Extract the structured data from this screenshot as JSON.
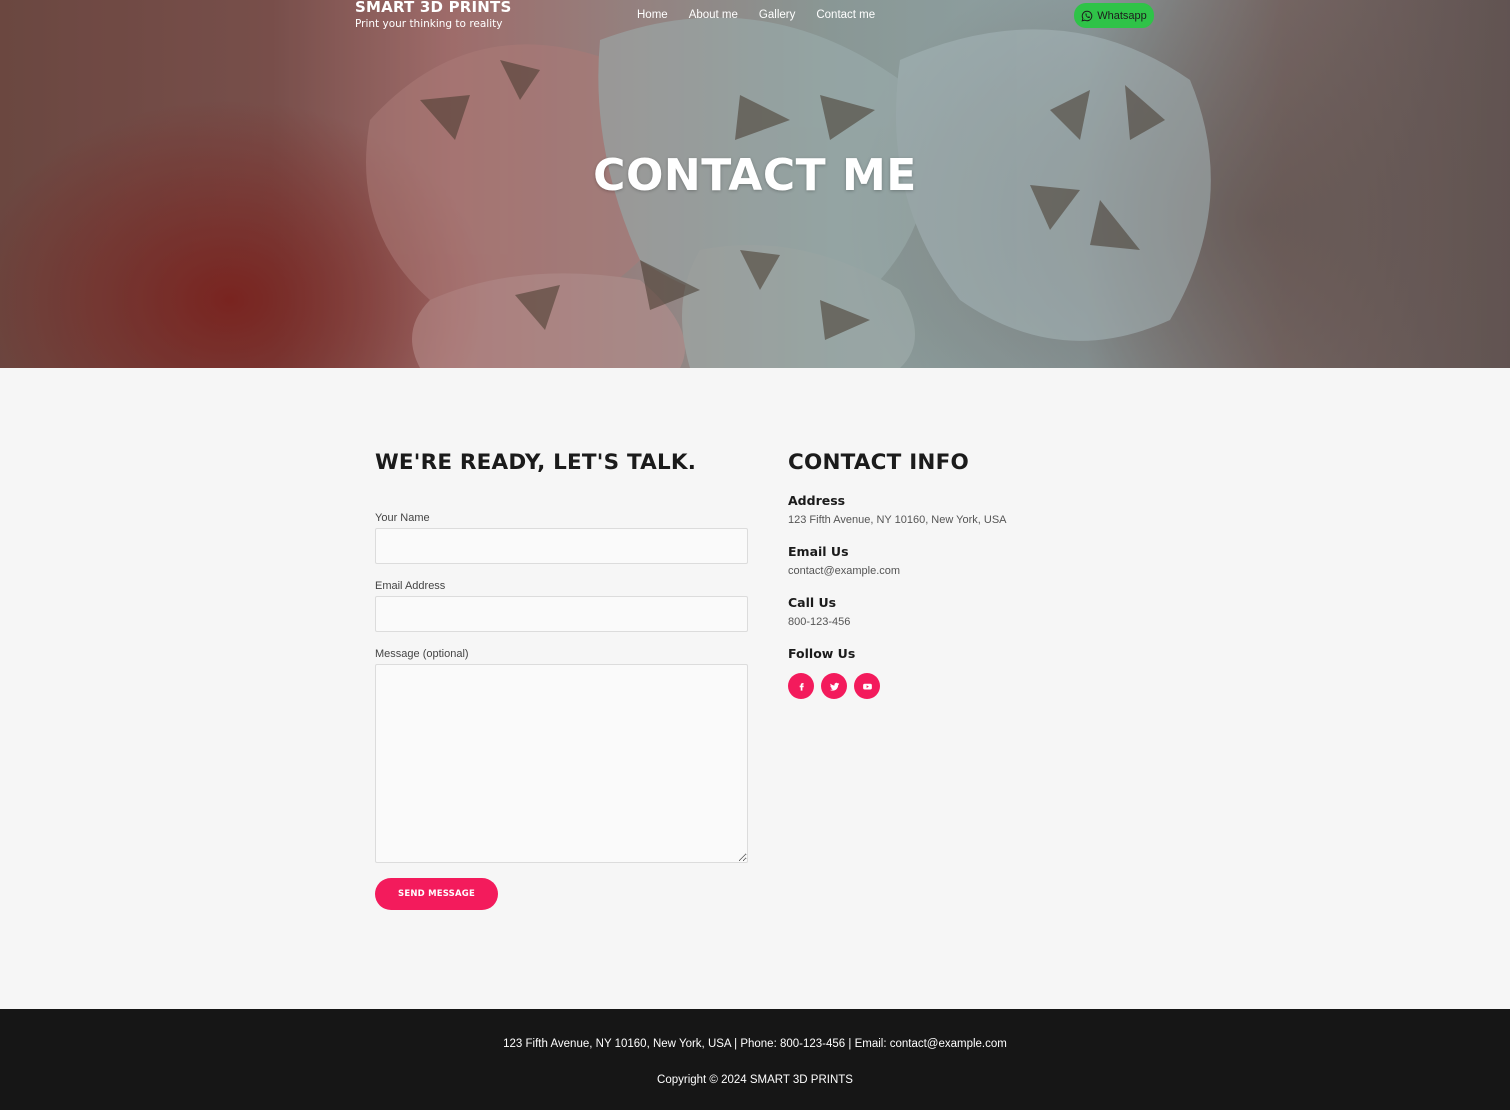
{
  "brand": {
    "name": "SMART 3D PRINTS",
    "tagline": "Print your thinking to reality"
  },
  "nav": {
    "items": [
      "Home",
      "About me",
      "Gallery",
      "Contact me"
    ]
  },
  "whatsapp": {
    "label": "Whatsapp",
    "icon": "whatsapp-icon"
  },
  "hero": {
    "title": "CONTACT ME"
  },
  "form": {
    "heading": "WE'RE READY, LET'S TALK.",
    "name_label": "Your Name",
    "name_value": "",
    "email_label": "Email Address",
    "email_value": "",
    "message_label": "Message (optional)",
    "message_value": "",
    "submit_label": "SEND MESSAGE"
  },
  "contact_info": {
    "heading": "CONTACT INFO",
    "address_label": "Address",
    "address_value": "123 Fifth Avenue, NY 10160, New York, USA",
    "email_label": "Email Us",
    "email_value": "contact@example.com",
    "phone_label": "Call Us",
    "phone_value": "800-123-456",
    "follow_label": "Follow Us",
    "social": [
      {
        "icon": "facebook-icon"
      },
      {
        "icon": "twitter-icon"
      },
      {
        "icon": "youtube-icon"
      }
    ]
  },
  "footer": {
    "info": "123 Fifth Avenue, NY 10160, New York, USA | Phone: 800-123-456 | Email: contact@example.com",
    "copyright": "Copyright © 2024 SMART 3D PRINTS"
  },
  "colors": {
    "accent": "#f31b5c",
    "whatsapp": "#2fc348",
    "footer_bg": "#161616",
    "page_bg": "#f6f6f6"
  }
}
